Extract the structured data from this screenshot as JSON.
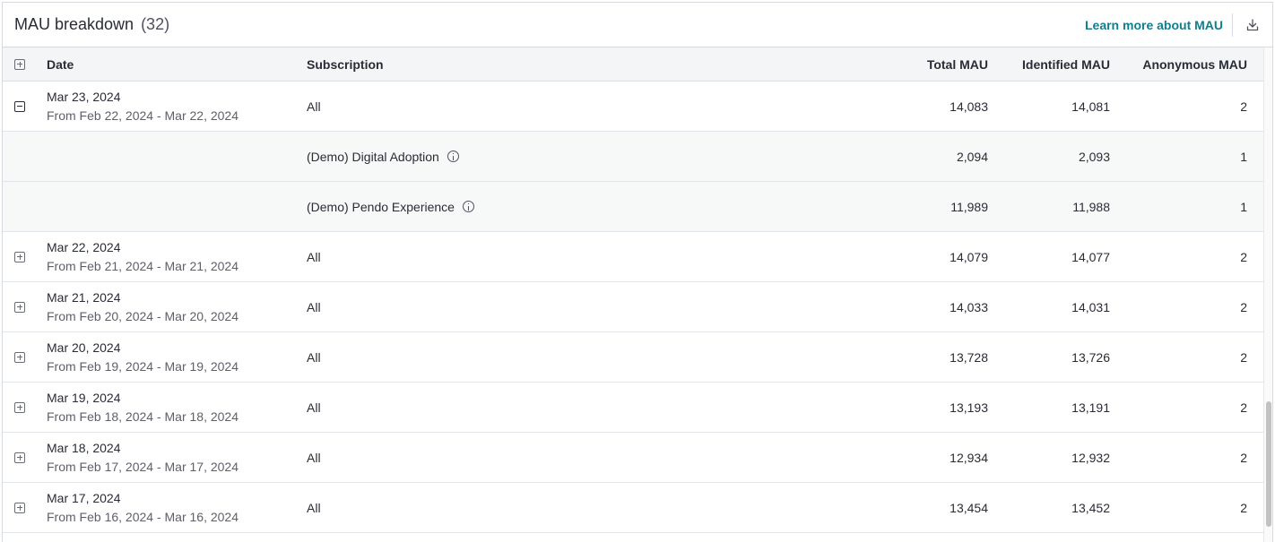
{
  "header": {
    "title": "MAU breakdown",
    "count": "(32)",
    "learn_more": "Learn more about MAU"
  },
  "columns": {
    "date": "Date",
    "subscription": "Subscription",
    "total": "Total MAU",
    "identified": "Identified MAU",
    "anonymous": "Anonymous MAU"
  },
  "rows": [
    {
      "type": "main",
      "expanded": true,
      "date": "Mar 23, 2024",
      "range": "From Feb 22, 2024 - Mar 22, 2024",
      "subscription": "All",
      "total": "14,083",
      "identified": "14,081",
      "anonymous": "2"
    },
    {
      "type": "sub",
      "subscription": "(Demo) Digital Adoption",
      "total": "2,094",
      "identified": "2,093",
      "anonymous": "1"
    },
    {
      "type": "sub",
      "subscription": "(Demo) Pendo Experience",
      "total": "11,989",
      "identified": "11,988",
      "anonymous": "1"
    },
    {
      "type": "main",
      "expanded": false,
      "date": "Mar 22, 2024",
      "range": "From Feb 21, 2024 - Mar 21, 2024",
      "subscription": "All",
      "total": "14,079",
      "identified": "14,077",
      "anonymous": "2"
    },
    {
      "type": "main",
      "expanded": false,
      "date": "Mar 21, 2024",
      "range": "From Feb 20, 2024 - Mar 20, 2024",
      "subscription": "All",
      "total": "14,033",
      "identified": "14,031",
      "anonymous": "2"
    },
    {
      "type": "main",
      "expanded": false,
      "date": "Mar 20, 2024",
      "range": "From Feb 19, 2024 - Mar 19, 2024",
      "subscription": "All",
      "total": "13,728",
      "identified": "13,726",
      "anonymous": "2"
    },
    {
      "type": "main",
      "expanded": false,
      "date": "Mar 19, 2024",
      "range": "From Feb 18, 2024 - Mar 18, 2024",
      "subscription": "All",
      "total": "13,193",
      "identified": "13,191",
      "anonymous": "2"
    },
    {
      "type": "main",
      "expanded": false,
      "date": "Mar 18, 2024",
      "range": "From Feb 17, 2024 - Mar 17, 2024",
      "subscription": "All",
      "total": "12,934",
      "identified": "12,932",
      "anonymous": "2"
    },
    {
      "type": "main",
      "expanded": false,
      "date": "Mar 17, 2024",
      "range": "From Feb 16, 2024 - Mar 16, 2024",
      "subscription": "All",
      "total": "13,454",
      "identified": "13,452",
      "anonymous": "2"
    }
  ]
}
